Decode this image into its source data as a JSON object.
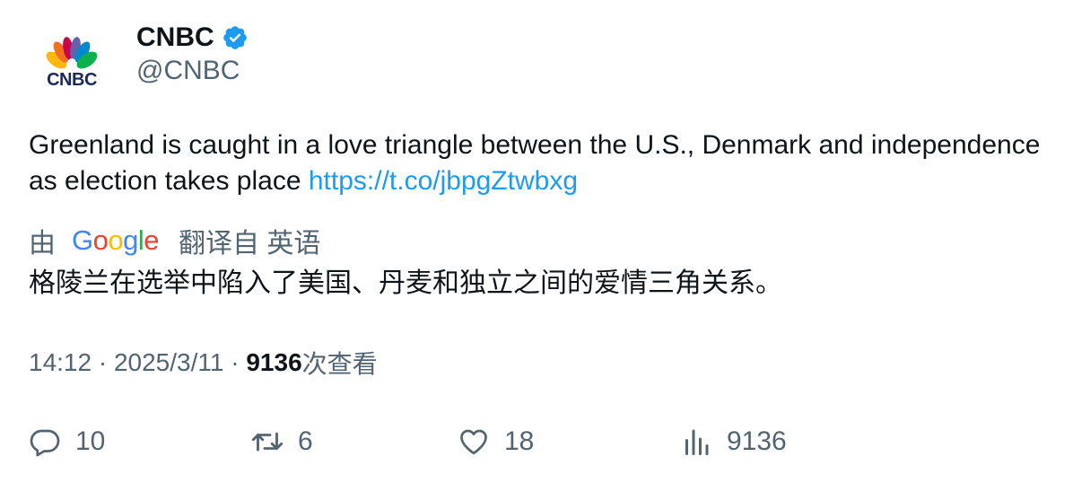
{
  "author": {
    "display_name": "CNBC",
    "handle": "@CNBC",
    "avatar_text": "CNBC",
    "verified_icon": "verified-badge-icon"
  },
  "tweet": {
    "text": "Greenland is caught in a love triangle between the U.S., Denmark and independence as election takes place ",
    "link": "https://t.co/jbpgZtwbxg"
  },
  "translation": {
    "prefix": "由",
    "provider": "Google",
    "suffix": "翻译自 英语",
    "text": "格陵兰在选举中陷入了美国、丹麦和独立之间的爱情三角关系。"
  },
  "meta": {
    "time": "14:12",
    "separator": " · ",
    "date": "2025/3/11",
    "views_count": "9136",
    "views_label": "次查看"
  },
  "actions": {
    "replies": "10",
    "retweets": "6",
    "likes": "18",
    "views": "9136"
  },
  "colors": {
    "link": "#1d9bf0",
    "secondary_text": "#536471",
    "primary_text": "#0f1419",
    "verified": "#1d9bf0"
  }
}
